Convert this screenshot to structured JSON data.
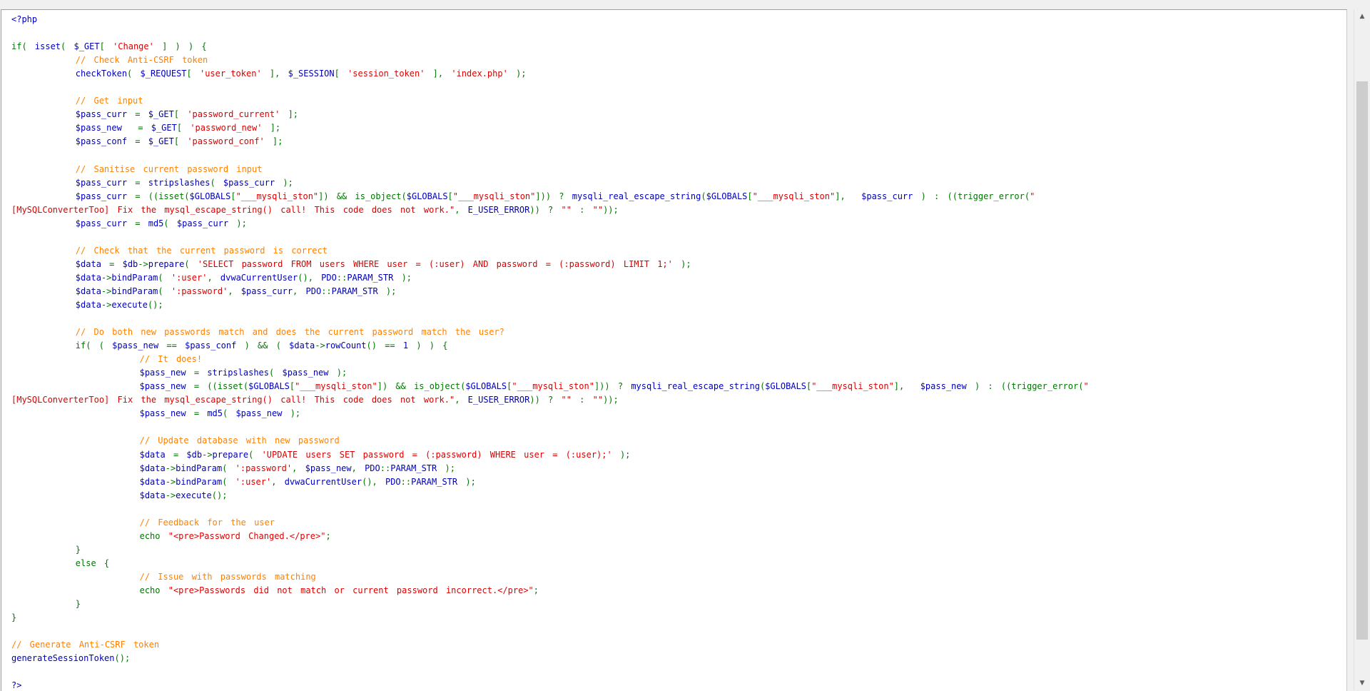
{
  "scrollbar": {
    "up_arrow_icon": "triangle-up",
    "down_arrow_icon": "triangle-down",
    "scroll_position": 0.1
  },
  "colors": {
    "default": "#0000bb",
    "keyword": "#007700",
    "string": "#dd0000",
    "comment": "#ff8000",
    "background": "#ffffff"
  },
  "code_lines": [
    [
      [
        "def",
        "<?php"
      ]
    ],
    [],
    [
      [
        "kw",
        "if( "
      ],
      [
        "def",
        "isset"
      ],
      [
        "kw",
        "( "
      ],
      [
        "def",
        "$_GET"
      ],
      [
        "kw",
        "[ "
      ],
      [
        "str",
        "'Change'"
      ],
      [
        "kw",
        " ] ) ) {"
      ]
    ],
    [
      [
        "com",
        "        // Check Anti-CSRF token"
      ]
    ],
    [
      [
        "def",
        "        checkToken"
      ],
      [
        "kw",
        "( "
      ],
      [
        "def",
        "$_REQUEST"
      ],
      [
        "kw",
        "[ "
      ],
      [
        "str",
        "'user_token'"
      ],
      [
        "kw",
        " ], "
      ],
      [
        "def",
        "$_SESSION"
      ],
      [
        "kw",
        "[ "
      ],
      [
        "str",
        "'session_token'"
      ],
      [
        "kw",
        " ], "
      ],
      [
        "str",
        "'index.php'"
      ],
      [
        "kw",
        " );"
      ]
    ],
    [],
    [
      [
        "com",
        "        // Get input"
      ]
    ],
    [
      [
        "def",
        "        $pass_curr"
      ],
      [
        "kw",
        " = "
      ],
      [
        "def",
        "$_GET"
      ],
      [
        "kw",
        "[ "
      ],
      [
        "str",
        "'password_current'"
      ],
      [
        "kw",
        " ];"
      ]
    ],
    [
      [
        "def",
        "        $pass_new"
      ],
      [
        "kw",
        "  = "
      ],
      [
        "def",
        "$_GET"
      ],
      [
        "kw",
        "[ "
      ],
      [
        "str",
        "'password_new'"
      ],
      [
        "kw",
        " ];"
      ]
    ],
    [
      [
        "def",
        "        $pass_conf"
      ],
      [
        "kw",
        " = "
      ],
      [
        "def",
        "$_GET"
      ],
      [
        "kw",
        "[ "
      ],
      [
        "str",
        "'password_conf'"
      ],
      [
        "kw",
        " ];"
      ]
    ],
    [],
    [
      [
        "com",
        "        // Sanitise current password input"
      ]
    ],
    [
      [
        "def",
        "        $pass_curr"
      ],
      [
        "kw",
        " = "
      ],
      [
        "def",
        "stripslashes"
      ],
      [
        "kw",
        "( "
      ],
      [
        "def",
        "$pass_curr"
      ],
      [
        "kw",
        " );"
      ]
    ],
    [
      [
        "def",
        "        $pass_curr"
      ],
      [
        "kw",
        " = ((isset("
      ],
      [
        "def",
        "$GLOBALS"
      ],
      [
        "kw",
        "["
      ],
      [
        "str",
        "\"___mysqli_ston\""
      ],
      [
        "kw",
        "]) && is_object("
      ],
      [
        "def",
        "$GLOBALS"
      ],
      [
        "kw",
        "["
      ],
      [
        "str",
        "\"___mysqli_ston\""
      ],
      [
        "kw",
        "])) ? "
      ],
      [
        "def",
        "mysqli_real_escape_string"
      ],
      [
        "kw",
        "("
      ],
      [
        "def",
        "$GLOBALS"
      ],
      [
        "kw",
        "["
      ],
      [
        "str",
        "\"___mysqli_ston\""
      ],
      [
        "kw",
        "],  "
      ],
      [
        "def",
        "$pass_curr"
      ],
      [
        "kw",
        " ) : ((trigger_error("
      ],
      [
        "str",
        "\""
      ]
    ],
    [
      [
        "str",
        "[MySQLConverterToo] Fix the mysql_escape_string() call! This code does not work.\""
      ],
      [
        "kw",
        ", "
      ],
      [
        "def",
        "E_USER_ERROR"
      ],
      [
        "kw",
        ")) ? "
      ],
      [
        "str",
        "\"\""
      ],
      [
        "kw",
        " : "
      ],
      [
        "str",
        "\"\""
      ],
      [
        "kw",
        "));"
      ]
    ],
    [
      [
        "def",
        "        $pass_curr"
      ],
      [
        "kw",
        " = "
      ],
      [
        "def",
        "md5"
      ],
      [
        "kw",
        "( "
      ],
      [
        "def",
        "$pass_curr"
      ],
      [
        "kw",
        " );"
      ]
    ],
    [],
    [
      [
        "com",
        "        // Check that the current password is correct"
      ]
    ],
    [
      [
        "def",
        "        $data"
      ],
      [
        "kw",
        " = "
      ],
      [
        "def",
        "$db"
      ],
      [
        "kw",
        "->"
      ],
      [
        "def",
        "prepare"
      ],
      [
        "kw",
        "( "
      ],
      [
        "str",
        "'SELECT password FROM users WHERE user = (:user) AND password = (:password) LIMIT 1;'"
      ],
      [
        "kw",
        " );"
      ]
    ],
    [
      [
        "def",
        "        $data"
      ],
      [
        "kw",
        "->"
      ],
      [
        "def",
        "bindParam"
      ],
      [
        "kw",
        "( "
      ],
      [
        "str",
        "':user'"
      ],
      [
        "kw",
        ", "
      ],
      [
        "def",
        "dvwaCurrentUser"
      ],
      [
        "kw",
        "(), "
      ],
      [
        "def",
        "PDO"
      ],
      [
        "kw",
        "::"
      ],
      [
        "def",
        "PARAM_STR"
      ],
      [
        "kw",
        " );"
      ]
    ],
    [
      [
        "def",
        "        $data"
      ],
      [
        "kw",
        "->"
      ],
      [
        "def",
        "bindParam"
      ],
      [
        "kw",
        "( "
      ],
      [
        "str",
        "':password'"
      ],
      [
        "kw",
        ", "
      ],
      [
        "def",
        "$pass_curr"
      ],
      [
        "kw",
        ", "
      ],
      [
        "def",
        "PDO"
      ],
      [
        "kw",
        "::"
      ],
      [
        "def",
        "PARAM_STR"
      ],
      [
        "kw",
        " );"
      ]
    ],
    [
      [
        "def",
        "        $data"
      ],
      [
        "kw",
        "->"
      ],
      [
        "def",
        "execute"
      ],
      [
        "kw",
        "();"
      ]
    ],
    [],
    [
      [
        "com",
        "        // Do both new passwords match and does the current password match the user?"
      ]
    ],
    [
      [
        "kw",
        "        if( ( "
      ],
      [
        "def",
        "$pass_new"
      ],
      [
        "kw",
        " == "
      ],
      [
        "def",
        "$pass_conf"
      ],
      [
        "kw",
        " ) && ( "
      ],
      [
        "def",
        "$data"
      ],
      [
        "kw",
        "->"
      ],
      [
        "def",
        "rowCount"
      ],
      [
        "kw",
        "() == "
      ],
      [
        "def",
        "1"
      ],
      [
        "kw",
        " ) ) {"
      ]
    ],
    [
      [
        "com",
        "                // It does!"
      ]
    ],
    [
      [
        "def",
        "                $pass_new"
      ],
      [
        "kw",
        " = "
      ],
      [
        "def",
        "stripslashes"
      ],
      [
        "kw",
        "( "
      ],
      [
        "def",
        "$pass_new"
      ],
      [
        "kw",
        " );"
      ]
    ],
    [
      [
        "def",
        "                $pass_new"
      ],
      [
        "kw",
        " = ((isset("
      ],
      [
        "def",
        "$GLOBALS"
      ],
      [
        "kw",
        "["
      ],
      [
        "str",
        "\"___mysqli_ston\""
      ],
      [
        "kw",
        "]) && is_object("
      ],
      [
        "def",
        "$GLOBALS"
      ],
      [
        "kw",
        "["
      ],
      [
        "str",
        "\"___mysqli_ston\""
      ],
      [
        "kw",
        "])) ? "
      ],
      [
        "def",
        "mysqli_real_escape_string"
      ],
      [
        "kw",
        "("
      ],
      [
        "def",
        "$GLOBALS"
      ],
      [
        "kw",
        "["
      ],
      [
        "str",
        "\"___mysqli_ston\""
      ],
      [
        "kw",
        "],  "
      ],
      [
        "def",
        "$pass_new"
      ],
      [
        "kw",
        " ) : ((trigger_error("
      ],
      [
        "str",
        "\""
      ]
    ],
    [
      [
        "str",
        "[MySQLConverterToo] Fix the mysql_escape_string() call! This code does not work.\""
      ],
      [
        "kw",
        ", "
      ],
      [
        "def",
        "E_USER_ERROR"
      ],
      [
        "kw",
        ")) ? "
      ],
      [
        "str",
        "\"\""
      ],
      [
        "kw",
        " : "
      ],
      [
        "str",
        "\"\""
      ],
      [
        "kw",
        "));"
      ]
    ],
    [
      [
        "def",
        "                $pass_new"
      ],
      [
        "kw",
        " = "
      ],
      [
        "def",
        "md5"
      ],
      [
        "kw",
        "( "
      ],
      [
        "def",
        "$pass_new"
      ],
      [
        "kw",
        " );"
      ]
    ],
    [],
    [
      [
        "com",
        "                // Update database with new password"
      ]
    ],
    [
      [
        "def",
        "                $data"
      ],
      [
        "kw",
        " = "
      ],
      [
        "def",
        "$db"
      ],
      [
        "kw",
        "->"
      ],
      [
        "def",
        "prepare"
      ],
      [
        "kw",
        "( "
      ],
      [
        "str",
        "'UPDATE users SET password = (:password) WHERE user = (:user);'"
      ],
      [
        "kw",
        " );"
      ]
    ],
    [
      [
        "def",
        "                $data"
      ],
      [
        "kw",
        "->"
      ],
      [
        "def",
        "bindParam"
      ],
      [
        "kw",
        "( "
      ],
      [
        "str",
        "':password'"
      ],
      [
        "kw",
        ", "
      ],
      [
        "def",
        "$pass_new"
      ],
      [
        "kw",
        ", "
      ],
      [
        "def",
        "PDO"
      ],
      [
        "kw",
        "::"
      ],
      [
        "def",
        "PARAM_STR"
      ],
      [
        "kw",
        " );"
      ]
    ],
    [
      [
        "def",
        "                $data"
      ],
      [
        "kw",
        "->"
      ],
      [
        "def",
        "bindParam"
      ],
      [
        "kw",
        "( "
      ],
      [
        "str",
        "':user'"
      ],
      [
        "kw",
        ", "
      ],
      [
        "def",
        "dvwaCurrentUser"
      ],
      [
        "kw",
        "(), "
      ],
      [
        "def",
        "PDO"
      ],
      [
        "kw",
        "::"
      ],
      [
        "def",
        "PARAM_STR"
      ],
      [
        "kw",
        " );"
      ]
    ],
    [
      [
        "def",
        "                $data"
      ],
      [
        "kw",
        "->"
      ],
      [
        "def",
        "execute"
      ],
      [
        "kw",
        "();"
      ]
    ],
    [],
    [
      [
        "com",
        "                // Feedback for the user"
      ]
    ],
    [
      [
        "kw",
        "                echo "
      ],
      [
        "str",
        "\"<pre>Password Changed.</pre>\""
      ],
      [
        "kw",
        ";"
      ]
    ],
    [
      [
        "kw",
        "        }"
      ]
    ],
    [
      [
        "kw",
        "        else {"
      ]
    ],
    [
      [
        "com",
        "                // Issue with passwords matching"
      ]
    ],
    [
      [
        "kw",
        "                echo "
      ],
      [
        "str",
        "\"<pre>Passwords did not match or current password incorrect.</pre>\""
      ],
      [
        "kw",
        ";"
      ]
    ],
    [
      [
        "kw",
        "        }"
      ]
    ],
    [
      [
        "kw",
        "}"
      ]
    ],
    [],
    [
      [
        "com",
        "// Generate Anti-CSRF token"
      ]
    ],
    [
      [
        "def",
        "generateSessionToken"
      ],
      [
        "kw",
        "();"
      ]
    ],
    [],
    [
      [
        "def",
        "?>"
      ]
    ]
  ]
}
